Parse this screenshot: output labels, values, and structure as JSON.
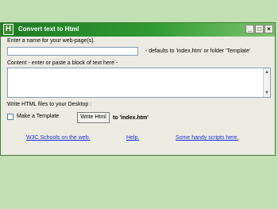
{
  "window": {
    "title": "Convert text to Html",
    "icon": "H",
    "controls": {
      "minimize": "_",
      "maximize": "□",
      "close": "×"
    }
  },
  "name_section": {
    "prompt": "Enter a name for your web-page(s).",
    "input_value": "",
    "hint": "- defaults to 'index.htm'   or   folder 'Template'"
  },
  "content_section": {
    "prompt": "Content - enter or paste a block of text here -",
    "textarea_value": ""
  },
  "write_section": {
    "label": "Write HTML files to your Desktop :",
    "checkbox_label": "Make a Template",
    "button_label": "Write Html",
    "target_text": "to 'index.htm'"
  },
  "links": {
    "w3c": "W3C Schools on the web.",
    "help": "Help.",
    "scripts": "Some handy scripts here."
  },
  "colors": {
    "background": "#c2e0b4",
    "titlebar_start": "#1f7a25",
    "titlebar_end": "#7fc56e",
    "window_face": "#ecebe3",
    "link": "#1c2fd6"
  },
  "icons": {
    "app": "html-h-icon",
    "scroll_up": "scroll-up-arrow-icon",
    "scroll_down": "scroll-down-arrow-icon"
  }
}
